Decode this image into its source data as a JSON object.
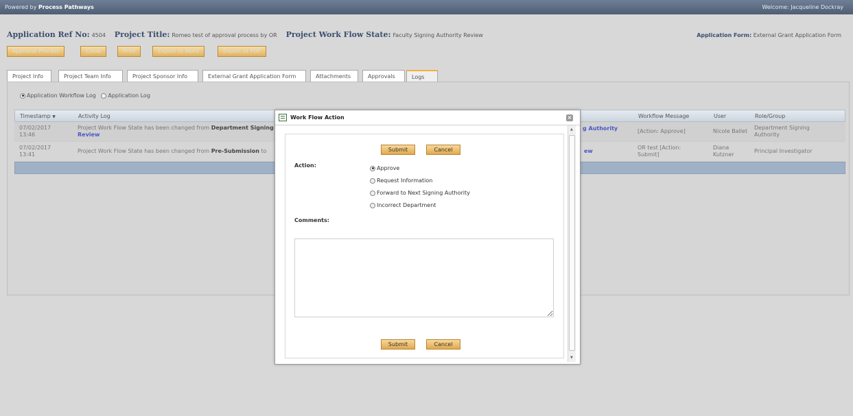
{
  "topbar": {
    "powered_prefix": "Powered by",
    "powered_brand": "Process Pathways",
    "welcome": "Welcome: Jacqueline Dockray"
  },
  "header": {
    "app_ref_label": "Application Ref No:",
    "app_ref_value": "4504",
    "project_title_label": "Project Title:",
    "project_title_value": "Romeo test of approval process by OR",
    "workflow_state_label": "Project Work Flow State:",
    "workflow_state_value": "Faculty Signing Authority Review",
    "app_form_label": "Application Form:",
    "app_form_value": "External Grant Application Form"
  },
  "toolbar": {
    "approval_process": "Approval Process",
    "close": "Close",
    "print": "Print",
    "export_word": "Export to Word",
    "export_pdf": "Export to PDF"
  },
  "tabs": [
    {
      "label": "Project Info"
    },
    {
      "label": "Project Team Info"
    },
    {
      "label": "Project Sponsor Info"
    },
    {
      "label": "External Grant Application Form"
    },
    {
      "label": "Attachments"
    },
    {
      "label": "Approvals"
    },
    {
      "label": "Logs"
    }
  ],
  "log_type": {
    "workflow_log": "Application Workflow Log",
    "app_log": "Application Log",
    "selected": "Application Workflow Log"
  },
  "grid": {
    "headers": {
      "timestamp": "Timestamp",
      "activity": "Activity Log",
      "message": "Workflow Message",
      "user": "User",
      "role": "Role/Group"
    },
    "rows": [
      {
        "date": "07/02/2017",
        "time": "13:46",
        "activity_prefix": "Project Work Flow State has been changed from",
        "activity_bold": "Department Signing",
        "activity_line2": "Review",
        "activity_right": "g Authority",
        "message": "[Action: Approve]",
        "user": "Nicole Ballet",
        "role_l1": "Department Signing",
        "role_l2": "Authority"
      },
      {
        "date": "07/02/2017",
        "time": "13:41",
        "activity_prefix": "Project Work Flow State has been changed from",
        "activity_bold": "Pre-Submission",
        "activity_suffix": "to",
        "activity_right": "ew",
        "message_l1": "OR test [Action:",
        "message_l2": "Submit]",
        "user_l1": "Diana",
        "user_l2": "Kutzner",
        "role": "Principal Investigator"
      }
    ]
  },
  "dialog": {
    "title": "Work Flow Action",
    "submit": "Submit",
    "cancel": "Cancel",
    "action_label": "Action:",
    "options": [
      "Approve",
      "Request Information",
      "Forward to Next Signing Authority",
      "Incorrect Department"
    ],
    "selected_option": "Approve",
    "comments_label": "Comments:",
    "comments_value": ""
  }
}
